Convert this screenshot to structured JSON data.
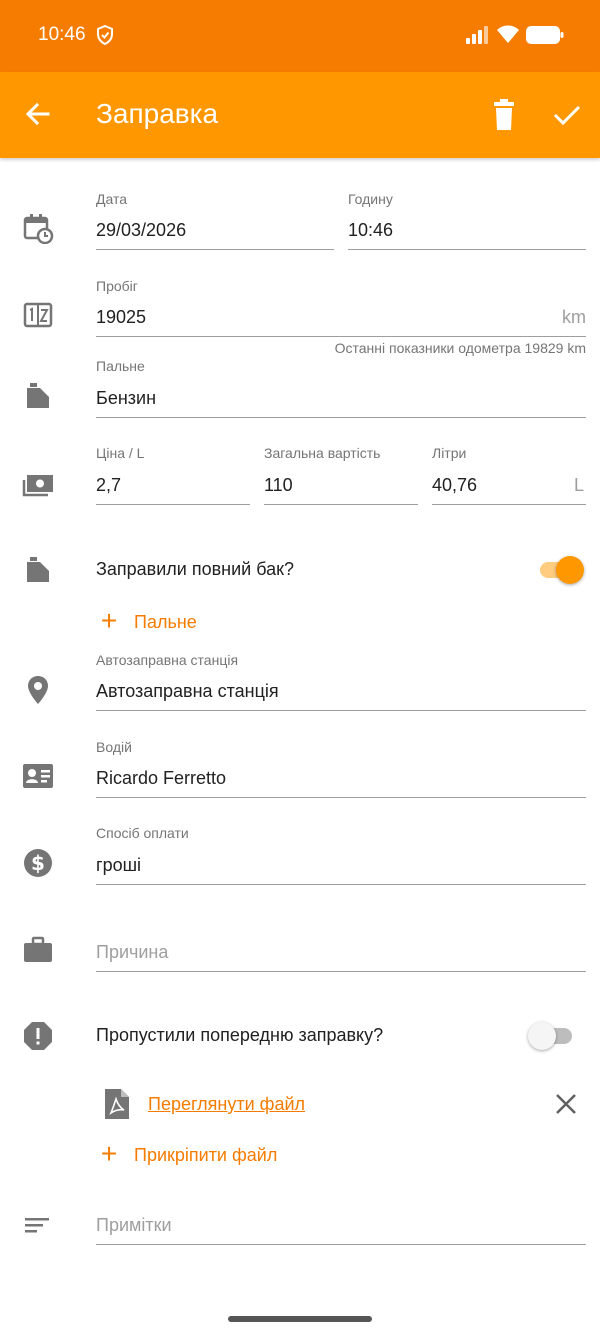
{
  "status_bar": {
    "time": "10:46"
  },
  "app_bar": {
    "title": "Заправка"
  },
  "form": {
    "date": {
      "label": "Дата",
      "value": "29/03/2026"
    },
    "time": {
      "label": "Годину",
      "value": "10:46"
    },
    "odometer": {
      "label": "Пробіг",
      "value": "19025",
      "unit": "km",
      "hint": "Останні показники одометра 19829 km"
    },
    "fuel": {
      "label": "Пальне",
      "value": "Бензин"
    },
    "price": {
      "label": "Ціна / L",
      "value": "2,7"
    },
    "total": {
      "label": "Загальна вартість",
      "value": "110"
    },
    "liters": {
      "label": "Літри",
      "value": "40,76",
      "unit": "L"
    },
    "full_tank": {
      "label": "Заправили повний бак?",
      "on": true
    },
    "add_fuel": {
      "label": "Пальне"
    },
    "station": {
      "label": "Автозаправна станція",
      "value": "Автозаправна станція"
    },
    "driver": {
      "label": "Водій",
      "value": "Ricardo Ferretto"
    },
    "payment": {
      "label": "Спосіб оплати",
      "value": "гроші"
    },
    "reason": {
      "placeholder": "Причина"
    },
    "missed": {
      "label": "Пропустили попередню заправку?",
      "on": false
    },
    "attachment": {
      "link_label": "Переглянути файл"
    },
    "attach_file": {
      "label": "Прикріпити файл"
    },
    "notes": {
      "placeholder": "Примітки"
    }
  },
  "colors": {
    "status_bar": "#f57c00",
    "app_bar": "#ff9800",
    "accent": "#f57c00",
    "icon": "#757575"
  }
}
